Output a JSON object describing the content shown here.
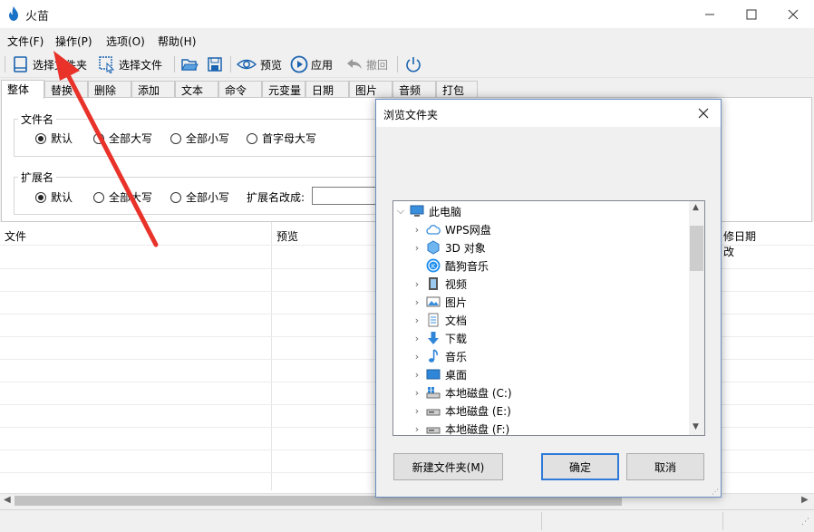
{
  "app": {
    "title": "火苗",
    "icon": "flame-icon"
  },
  "window_buttons": [
    "minimize-icon",
    "maximize-icon",
    "close-icon"
  ],
  "menu": [
    "文件(F)",
    "操作(P)",
    "选项(O)",
    "帮助(H)"
  ],
  "toolbar": {
    "select_folder": "选择文件夹",
    "select_file": "选择文件",
    "preview": "预览",
    "apply": "应用",
    "undo": "撤回"
  },
  "tabs": [
    "整体",
    "替换",
    "删除",
    "添加",
    "文本",
    "命令",
    "元变量",
    "日期",
    "图片",
    "音频",
    "打包"
  ],
  "panel": {
    "filename_group": "文件名",
    "filename_options": [
      "默认",
      "全部大写",
      "全部小写",
      "首字母大写"
    ],
    "ext_group": "扩展名",
    "ext_options": [
      "默认",
      "全部大写",
      "全部小写"
    ],
    "ext_change_label": "扩展名改成:",
    "ext_change_value": ""
  },
  "list": {
    "col_file": "文件",
    "col_preview": "预览",
    "col_date": "日期",
    "col_date_prefix": "修改"
  },
  "dialog": {
    "title": "浏览文件夹",
    "tree": [
      {
        "label": "此电脑",
        "icon": "computer-icon",
        "expanded": true
      },
      {
        "label": "WPS网盘",
        "icon": "cloud-icon"
      },
      {
        "label": "3D 对象",
        "icon": "cube-icon"
      },
      {
        "label": "酷狗音乐",
        "icon": "kugou-icon"
      },
      {
        "label": "视频",
        "icon": "video-icon"
      },
      {
        "label": "图片",
        "icon": "picture-icon"
      },
      {
        "label": "文档",
        "icon": "document-icon"
      },
      {
        "label": "下载",
        "icon": "download-icon"
      },
      {
        "label": "音乐",
        "icon": "music-icon"
      },
      {
        "label": "桌面",
        "icon": "desktop-icon"
      },
      {
        "label": "本地磁盘 (C:)",
        "icon": "drive-icon"
      },
      {
        "label": "本地磁盘 (E:)",
        "icon": "drive-icon"
      },
      {
        "label": "本地磁盘 (F:)",
        "icon": "drive-icon"
      }
    ],
    "new_folder": "新建文件夹(M)",
    "ok": "确定",
    "cancel": "取消"
  },
  "colors": {
    "arrow": "#e8322a",
    "accent": "#1a73c7"
  }
}
